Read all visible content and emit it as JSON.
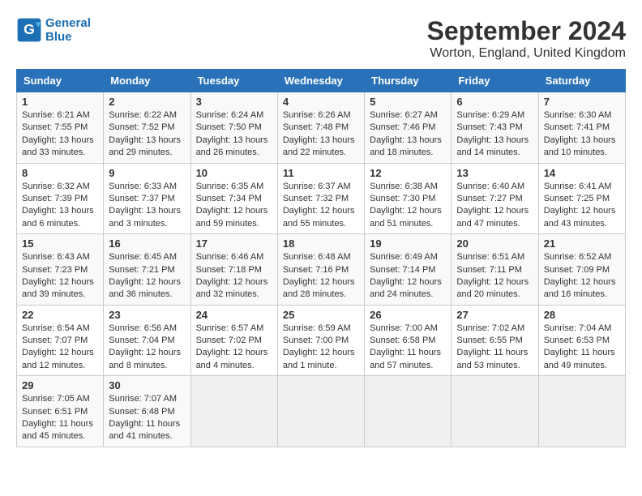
{
  "header": {
    "logo_line1": "General",
    "logo_line2": "Blue",
    "month": "September 2024",
    "location": "Worton, England, United Kingdom"
  },
  "weekdays": [
    "Sunday",
    "Monday",
    "Tuesday",
    "Wednesday",
    "Thursday",
    "Friday",
    "Saturday"
  ],
  "weeks": [
    [
      {
        "day": "1",
        "sunrise": "6:21 AM",
        "sunset": "7:55 PM",
        "daylight": "Daylight: 13 hours and 33 minutes."
      },
      {
        "day": "2",
        "sunrise": "6:22 AM",
        "sunset": "7:52 PM",
        "daylight": "Daylight: 13 hours and 29 minutes."
      },
      {
        "day": "3",
        "sunrise": "6:24 AM",
        "sunset": "7:50 PM",
        "daylight": "Daylight: 13 hours and 26 minutes."
      },
      {
        "day": "4",
        "sunrise": "6:26 AM",
        "sunset": "7:48 PM",
        "daylight": "Daylight: 13 hours and 22 minutes."
      },
      {
        "day": "5",
        "sunrise": "6:27 AM",
        "sunset": "7:46 PM",
        "daylight": "Daylight: 13 hours and 18 minutes."
      },
      {
        "day": "6",
        "sunrise": "6:29 AM",
        "sunset": "7:43 PM",
        "daylight": "Daylight: 13 hours and 14 minutes."
      },
      {
        "day": "7",
        "sunrise": "6:30 AM",
        "sunset": "7:41 PM",
        "daylight": "Daylight: 13 hours and 10 minutes."
      }
    ],
    [
      {
        "day": "8",
        "sunrise": "6:32 AM",
        "sunset": "7:39 PM",
        "daylight": "Daylight: 13 hours and 6 minutes."
      },
      {
        "day": "9",
        "sunrise": "6:33 AM",
        "sunset": "7:37 PM",
        "daylight": "Daylight: 13 hours and 3 minutes."
      },
      {
        "day": "10",
        "sunrise": "6:35 AM",
        "sunset": "7:34 PM",
        "daylight": "Daylight: 12 hours and 59 minutes."
      },
      {
        "day": "11",
        "sunrise": "6:37 AM",
        "sunset": "7:32 PM",
        "daylight": "Daylight: 12 hours and 55 minutes."
      },
      {
        "day": "12",
        "sunrise": "6:38 AM",
        "sunset": "7:30 PM",
        "daylight": "Daylight: 12 hours and 51 minutes."
      },
      {
        "day": "13",
        "sunrise": "6:40 AM",
        "sunset": "7:27 PM",
        "daylight": "Daylight: 12 hours and 47 minutes."
      },
      {
        "day": "14",
        "sunrise": "6:41 AM",
        "sunset": "7:25 PM",
        "daylight": "Daylight: 12 hours and 43 minutes."
      }
    ],
    [
      {
        "day": "15",
        "sunrise": "6:43 AM",
        "sunset": "7:23 PM",
        "daylight": "Daylight: 12 hours and 39 minutes."
      },
      {
        "day": "16",
        "sunrise": "6:45 AM",
        "sunset": "7:21 PM",
        "daylight": "Daylight: 12 hours and 36 minutes."
      },
      {
        "day": "17",
        "sunrise": "6:46 AM",
        "sunset": "7:18 PM",
        "daylight": "Daylight: 12 hours and 32 minutes."
      },
      {
        "day": "18",
        "sunrise": "6:48 AM",
        "sunset": "7:16 PM",
        "daylight": "Daylight: 12 hours and 28 minutes."
      },
      {
        "day": "19",
        "sunrise": "6:49 AM",
        "sunset": "7:14 PM",
        "daylight": "Daylight: 12 hours and 24 minutes."
      },
      {
        "day": "20",
        "sunrise": "6:51 AM",
        "sunset": "7:11 PM",
        "daylight": "Daylight: 12 hours and 20 minutes."
      },
      {
        "day": "21",
        "sunrise": "6:52 AM",
        "sunset": "7:09 PM",
        "daylight": "Daylight: 12 hours and 16 minutes."
      }
    ],
    [
      {
        "day": "22",
        "sunrise": "6:54 AM",
        "sunset": "7:07 PM",
        "daylight": "Daylight: 12 hours and 12 minutes."
      },
      {
        "day": "23",
        "sunrise": "6:56 AM",
        "sunset": "7:04 PM",
        "daylight": "Daylight: 12 hours and 8 minutes."
      },
      {
        "day": "24",
        "sunrise": "6:57 AM",
        "sunset": "7:02 PM",
        "daylight": "Daylight: 12 hours and 4 minutes."
      },
      {
        "day": "25",
        "sunrise": "6:59 AM",
        "sunset": "7:00 PM",
        "daylight": "Daylight: 12 hours and 1 minute."
      },
      {
        "day": "26",
        "sunrise": "7:00 AM",
        "sunset": "6:58 PM",
        "daylight": "Daylight: 11 hours and 57 minutes."
      },
      {
        "day": "27",
        "sunrise": "7:02 AM",
        "sunset": "6:55 PM",
        "daylight": "Daylight: 11 hours and 53 minutes."
      },
      {
        "day": "28",
        "sunrise": "7:04 AM",
        "sunset": "6:53 PM",
        "daylight": "Daylight: 11 hours and 49 minutes."
      }
    ],
    [
      {
        "day": "29",
        "sunrise": "7:05 AM",
        "sunset": "6:51 PM",
        "daylight": "Daylight: 11 hours and 45 minutes."
      },
      {
        "day": "30",
        "sunrise": "7:07 AM",
        "sunset": "6:48 PM",
        "daylight": "Daylight: 11 hours and 41 minutes."
      },
      null,
      null,
      null,
      null,
      null
    ]
  ]
}
